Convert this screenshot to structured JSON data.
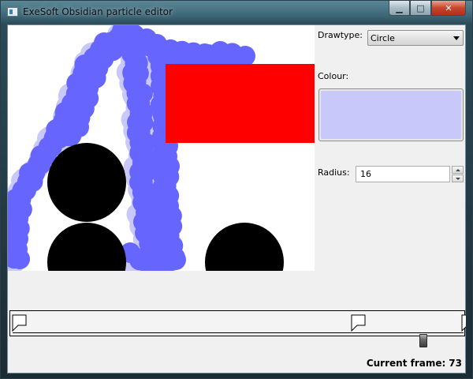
{
  "window": {
    "title": "ExeSoft Obsidian particle editor",
    "minimize_glyph": "▁",
    "maximize_glyph": "□",
    "close_glyph": "✕",
    "app_icon": "window-app-icon"
  },
  "side": {
    "drawtype_label": "Drawtype:",
    "drawtype_value": "Circle",
    "colour_label": "Colour:",
    "colour_value": "#c8c8fa",
    "radius_label": "Radius:",
    "radius_value": "16"
  },
  "canvas": {
    "background": "#ffffff",
    "particle_color": "#6666ff",
    "particle_trail_color": "#c8c8fa",
    "rect_color": "#ff0000",
    "circle_color": "#000000"
  },
  "timeline": {
    "keyframes_count_shown": 3,
    "slider_icon": "slider-thumb"
  },
  "status": {
    "current_frame_label": "Current frame:",
    "current_frame_value": "73"
  }
}
